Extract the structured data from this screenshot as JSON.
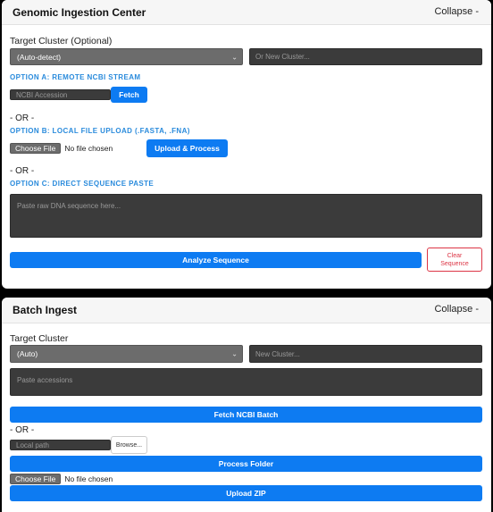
{
  "ingestion": {
    "title": "Genomic Ingestion Center",
    "collapse_label": "Collapse -",
    "target_cluster_label": "Target Cluster (Optional)",
    "cluster_select_value": "(Auto-detect)",
    "new_cluster_placeholder": "Or New Cluster...",
    "option_a_heading": "OPTION A: REMOTE NCBI STREAM",
    "accession_placeholder": "NCBI Accession",
    "fetch_label": "Fetch",
    "or_label_1": "- OR -",
    "option_b_heading": "OPTION B: LOCAL FILE UPLOAD (.FASTA, .FNA)",
    "choose_file_label": "Choose File",
    "no_file_label": "No file chosen",
    "upload_process_label": "Upload & Process",
    "or_label_2": "- OR -",
    "option_c_heading": "OPTION C: DIRECT SEQUENCE PASTE",
    "sequence_placeholder": "Paste raw DNA sequence here...",
    "analyze_label": "Analyze Sequence",
    "clear_label": "Clear Sequence"
  },
  "batch": {
    "title": "Batch Ingest",
    "collapse_label": "Collapse -",
    "target_cluster_label": "Target Cluster",
    "cluster_select_value": "(Auto)",
    "new_cluster_placeholder": "New Cluster...",
    "accessions_placeholder": "Paste accessions",
    "fetch_batch_label": "Fetch NCBI Batch",
    "or_label": "- OR -",
    "local_path_placeholder": "Local path",
    "browse_label": "Browse...",
    "process_folder_label": "Process Folder",
    "choose_file_label": "Choose File",
    "no_file_label": "No file chosen",
    "upload_zip_label": "Upload ZIP"
  }
}
